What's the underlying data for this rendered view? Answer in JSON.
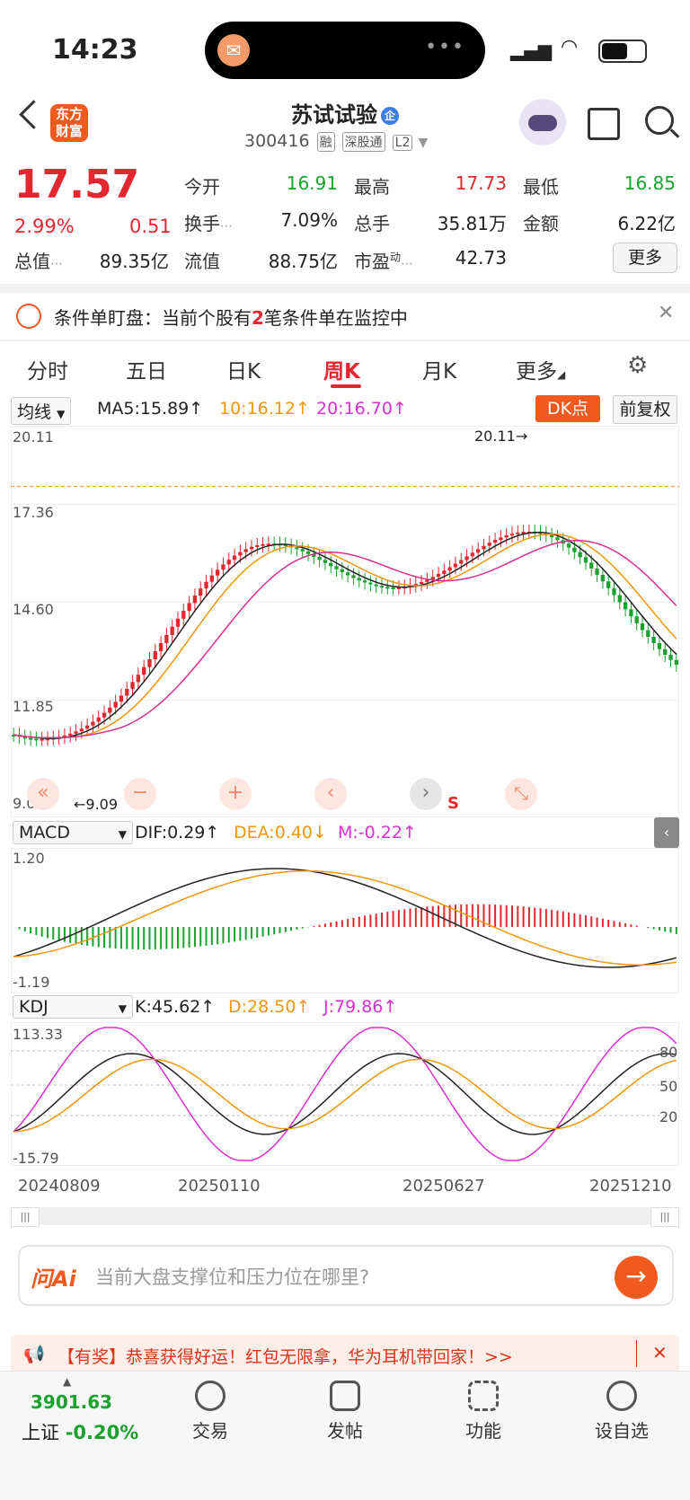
{
  "status_bar": {
    "time": "14:23"
  },
  "header": {
    "logo_text": "东方财富",
    "stock_name": "苏试试验",
    "name_badge": "企",
    "stock_code": "300416",
    "tags": [
      "融",
      "深股通",
      "L2"
    ]
  },
  "quote": {
    "price": "17.57",
    "change_pct": "2.99%",
    "change_amt": "0.51",
    "fields": [
      {
        "label": "今开",
        "value": "16.91",
        "color": "green"
      },
      {
        "label": "最高",
        "value": "17.73",
        "color": "red"
      },
      {
        "label": "最低",
        "value": "16.85",
        "color": "green"
      },
      {
        "label": "换手",
        "value": "7.09%",
        "color": "black"
      },
      {
        "label": "总手",
        "value": "35.81万",
        "color": "black"
      },
      {
        "label": "金额",
        "value": "6.22亿",
        "color": "black"
      },
      {
        "label": "总值",
        "value": "89.35亿",
        "color": "black"
      },
      {
        "label": "流值",
        "value": "88.75亿",
        "color": "black"
      },
      {
        "label": "市盈",
        "value": "42.73",
        "color": "black"
      }
    ],
    "pe_sup": "动",
    "more_label": "更多"
  },
  "notice": {
    "prefix": "条件单盯盘：当前个股有",
    "count": "2",
    "suffix": "笔条件单在监控中"
  },
  "tabs": [
    "分时",
    "五日",
    "日K",
    "周K",
    "月K",
    "更多"
  ],
  "active_tab": "周K",
  "kline": {
    "indicator_select": "均线",
    "ma5": "MA5:15.89",
    "ma10": "10:16.12",
    "ma20": "20:16.70",
    "dk_label": "DK点",
    "adjust_label": "前复权",
    "y_labels": [
      "20.11",
      "17.36",
      "14.60",
      "11.85",
      "9.09"
    ],
    "max_label": "20.11",
    "min_label": "9.09",
    "controls": [
      "«",
      "−",
      "+",
      "‹",
      "›",
      "⤡"
    ],
    "s_label": "S"
  },
  "macd": {
    "select": "MACD",
    "dif": "DIF:0.29",
    "dea": "DEA:0.40",
    "m": "M:-0.22",
    "y_top": "1.20",
    "y_bottom": "-1.19"
  },
  "kdj": {
    "select": "KDJ",
    "k": "K:45.62",
    "d": "D:28.50",
    "j": "J:79.86",
    "y_top": "113.33",
    "y_bottom": "-15.79",
    "right_labels": [
      "80",
      "50",
      "20"
    ]
  },
  "dates": [
    "20240809",
    "20250110",
    "20250627",
    "20251210"
  ],
  "ask": {
    "logo": "问Ai",
    "placeholder": "当前大盘支撑位和压力位在哪里?"
  },
  "promo": {
    "text": "【有奖】恭喜获得好运！红包无限拿，华为耳机带回家！>>"
  },
  "bottom_nav": {
    "index_value": "3901.63",
    "index_name": "上证",
    "index_change": "-0.20%",
    "items": [
      "交易",
      "发帖",
      "功能",
      "设自选"
    ]
  }
}
